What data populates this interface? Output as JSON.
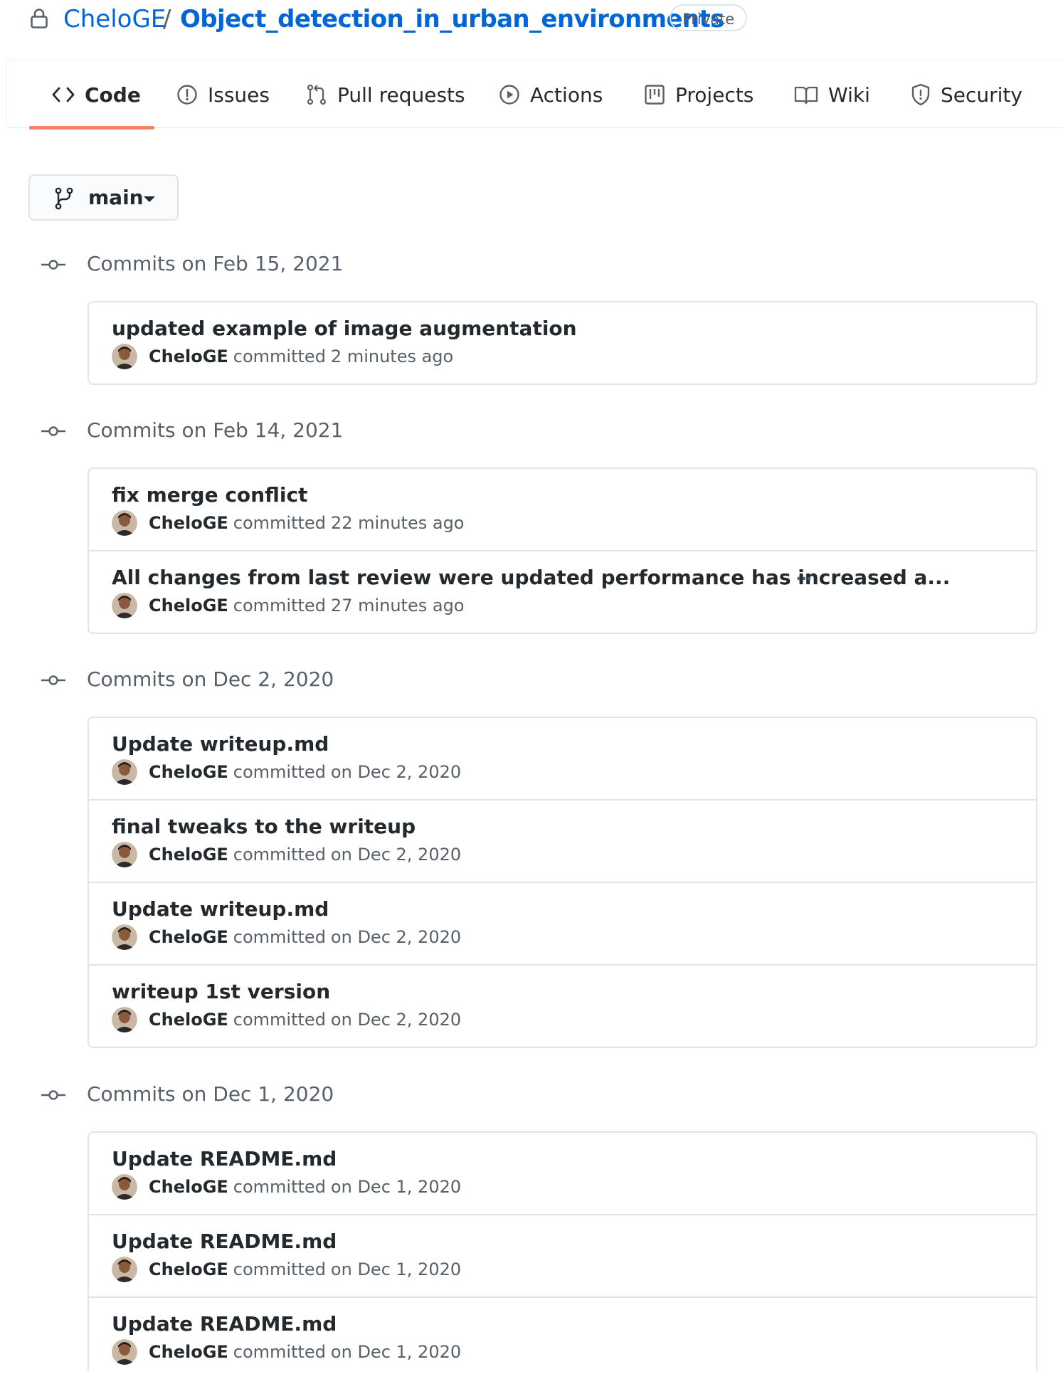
{
  "repo": {
    "owner": "CheloGE",
    "separator": "/",
    "name": "Object_detection_in_urban_environments",
    "visibility": "Private"
  },
  "tabs": [
    {
      "label": "Code",
      "icon": "code-icon",
      "selected": true
    },
    {
      "label": "Issues",
      "icon": "issue-icon"
    },
    {
      "label": "Pull requests",
      "icon": "pull-request-icon"
    },
    {
      "label": "Actions",
      "icon": "play-icon"
    },
    {
      "label": "Projects",
      "icon": "project-icon"
    },
    {
      "label": "Wiki",
      "icon": "book-icon"
    },
    {
      "label": "Security",
      "icon": "shield-icon"
    }
  ],
  "branch": {
    "name": "main",
    "icon": "git-branch-icon"
  },
  "colors": {
    "link": "#0366d6",
    "tab_underline": "#f9826c",
    "border": "#e1e4e8",
    "muted": "#586069"
  },
  "commit_groups": [
    {
      "title": "Commits on Feb 15, 2021",
      "commits": [
        {
          "message": "updated example of image augmentation",
          "author": "CheloGE",
          "action": "committed",
          "time": "2 minutes ago"
        }
      ]
    },
    {
      "title": "Commits on Feb 14, 2021",
      "commits": [
        {
          "message": "fix merge conflict",
          "author": "CheloGE",
          "action": "committed",
          "time": "22 minutes ago"
        },
        {
          "message": "All changes from last review were updated performance has increased a...",
          "author": "CheloGE",
          "action": "committed",
          "time": "27 minutes ago",
          "more": "…"
        }
      ]
    },
    {
      "title": "Commits on Dec 2, 2020",
      "commits": [
        {
          "message": "Update writeup.md",
          "author": "CheloGE",
          "action": "committed",
          "time": "on Dec 2, 2020"
        },
        {
          "message": "final tweaks to the writeup",
          "author": "CheloGE",
          "action": "committed",
          "time": "on Dec 2, 2020"
        },
        {
          "message": "Update writeup.md",
          "author": "CheloGE",
          "action": "committed",
          "time": "on Dec 2, 2020"
        },
        {
          "message": "writeup 1st version",
          "author": "CheloGE",
          "action": "committed",
          "time": "on Dec 2, 2020"
        }
      ]
    },
    {
      "title": "Commits on Dec 1, 2020",
      "commits": [
        {
          "message": "Update README.md",
          "author": "CheloGE",
          "action": "committed",
          "time": "on Dec 1, 2020"
        },
        {
          "message": "Update README.md",
          "author": "CheloGE",
          "action": "committed",
          "time": "on Dec 1, 2020"
        },
        {
          "message": "Update README.md",
          "author": "CheloGE",
          "action": "committed",
          "time": "on Dec 1, 2020"
        }
      ]
    }
  ]
}
